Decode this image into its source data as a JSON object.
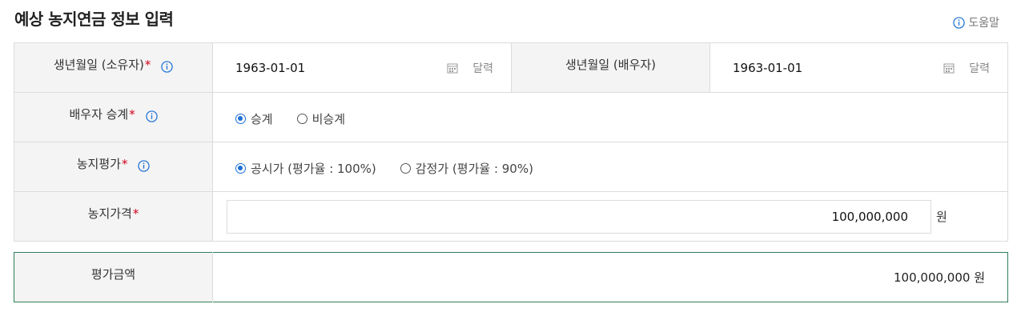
{
  "header": {
    "title": "예상 농지연금 정보 입력",
    "help_label": "도움말"
  },
  "form": {
    "birth_owner": {
      "label": "생년월일 (소유자)",
      "required_mark": "*",
      "value": "1963-01-01",
      "calendar_label": "달력"
    },
    "birth_spouse": {
      "label": "생년월일 (배우자)",
      "value": "1963-01-01",
      "calendar_label": "달력"
    },
    "spouse_succession": {
      "label": "배우자 승계",
      "required_mark": "*",
      "options": [
        "승계",
        "비승계"
      ],
      "selected": "승계"
    },
    "land_valuation": {
      "label": "농지평가",
      "required_mark": "*",
      "options": [
        "공시가 (평가율 : 100%)",
        "감정가 (평가율 : 90%)"
      ],
      "selected": "공시가 (평가율 : 100%)"
    },
    "land_price": {
      "label": "농지가격",
      "required_mark": "*",
      "value": "100,000,000",
      "unit": "원"
    }
  },
  "result": {
    "label": "평가금액",
    "value": "100,000,000 원"
  },
  "colors": {
    "accent": "#1a6fd4",
    "required": "#d0021b",
    "result_border": "#2e7d5a",
    "label_bg": "#f4f4f4"
  },
  "icons": {
    "info": "info-icon",
    "calendar": "calendar-icon"
  }
}
